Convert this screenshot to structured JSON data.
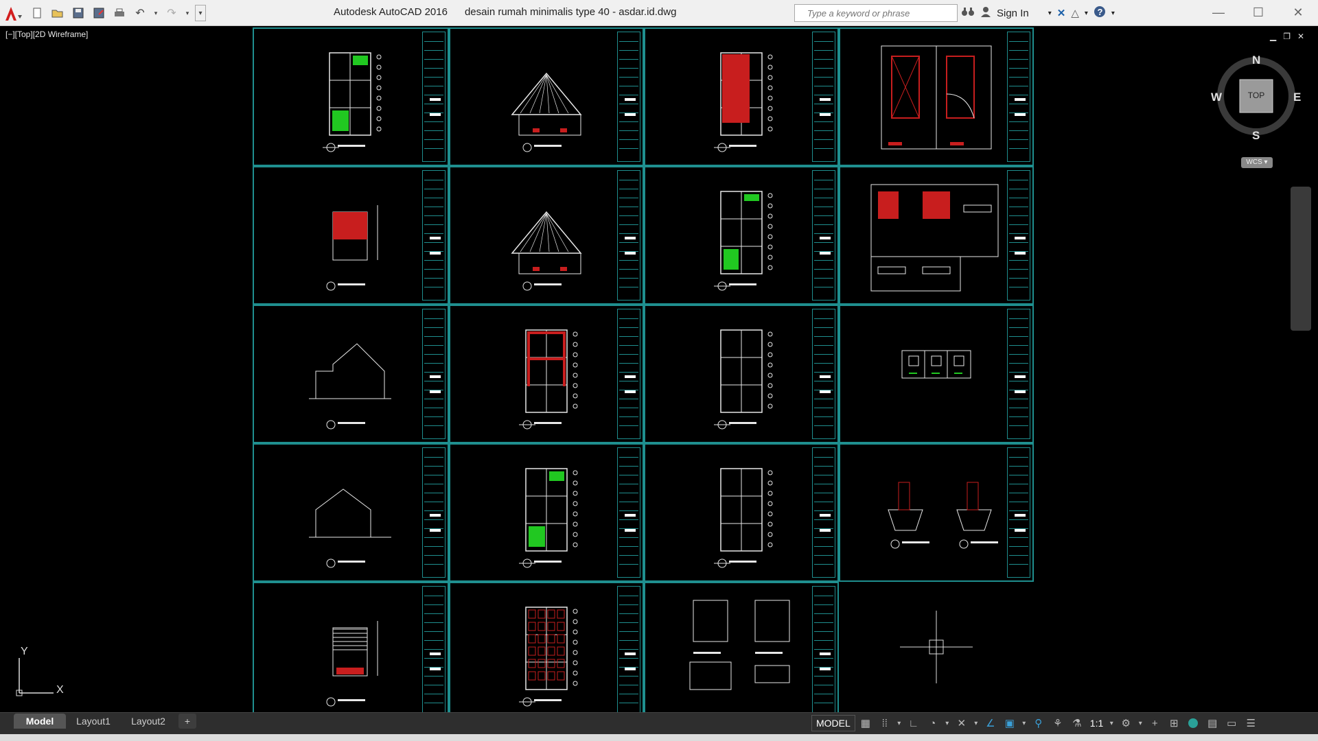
{
  "window": {
    "app_title": "Autodesk AutoCAD 2016",
    "file_title": "desain rumah minimalis type 40 - asdar.id.dwg"
  },
  "search": {
    "placeholder": "Type a keyword or phrase"
  },
  "account": {
    "signin_label": "Sign In"
  },
  "viewport": {
    "label": "[−][Top][2D Wireframe]"
  },
  "viewcube": {
    "north": "N",
    "south": "S",
    "east": "E",
    "west": "W",
    "face": "TOP",
    "ucs": "WCS"
  },
  "ucs_icon": {
    "y_label": "Y",
    "x_label": "X"
  },
  "tabs": [
    {
      "label": "Model"
    },
    {
      "label": "Layout1"
    },
    {
      "label": "Layout2"
    },
    {
      "label": "+"
    }
  ],
  "status": {
    "model_label": "MODEL",
    "scale_label": "1:1"
  },
  "colors": {
    "sheet_border": "#1f8f8f",
    "accent_red": "#c81e1e",
    "accent_green": "#21c821",
    "titlebar": "#f0f0f0",
    "statusbar": "#2e2e2e"
  },
  "icons": [
    "autocad-logo-icon",
    "new-icon",
    "open-icon",
    "save-icon",
    "saveas-icon",
    "print-icon",
    "undo-icon",
    "redo-icon",
    "binoculars-icon",
    "user-icon",
    "exchange-icon",
    "triangle-icon",
    "help-icon"
  ]
}
